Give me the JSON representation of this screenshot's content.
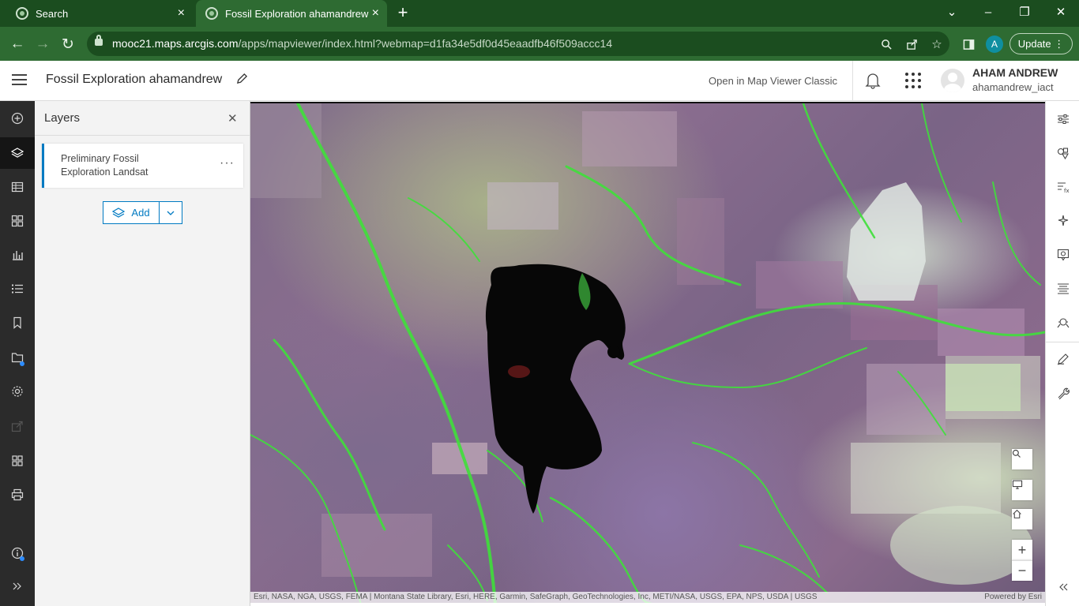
{
  "browser": {
    "tabs": [
      {
        "title": "Search"
      },
      {
        "title": "Fossil Exploration ahamandrew"
      }
    ],
    "new_tab_label": "+",
    "url_host": "mooc21.maps.arcgis.com",
    "url_path": "/apps/mapviewer/index.html?webmap=d1fa34e5df0d45eaadfb46f509accc14",
    "profile_initial": "A",
    "update_label": "Update"
  },
  "header": {
    "title": "Fossil Exploration ahamandrew",
    "open_classic": "Open in Map Viewer Classic",
    "user_name": "AHAM ANDREW",
    "user_id": "ahamandrew_iact"
  },
  "layers_panel": {
    "title": "Layers",
    "layers": [
      {
        "name": "Preliminary Fossil Exploration Landsat"
      }
    ],
    "add_label": "Add"
  },
  "map": {
    "attribution": "Esri, NASA, NGA, USGS, FEMA | Montana State Library, Esri, HERE, Garmin, SafeGraph, GeoTechnologies, Inc, METI/NASA, USGS, EPA, NPS, USDA | USGS",
    "powered_by": "Powered by Esri"
  },
  "colors": {
    "tab_strip": "#1b4d1f",
    "toolbar": "#2e6b32",
    "accent": "#007ac2",
    "action_bar": "#2b2b2b"
  }
}
